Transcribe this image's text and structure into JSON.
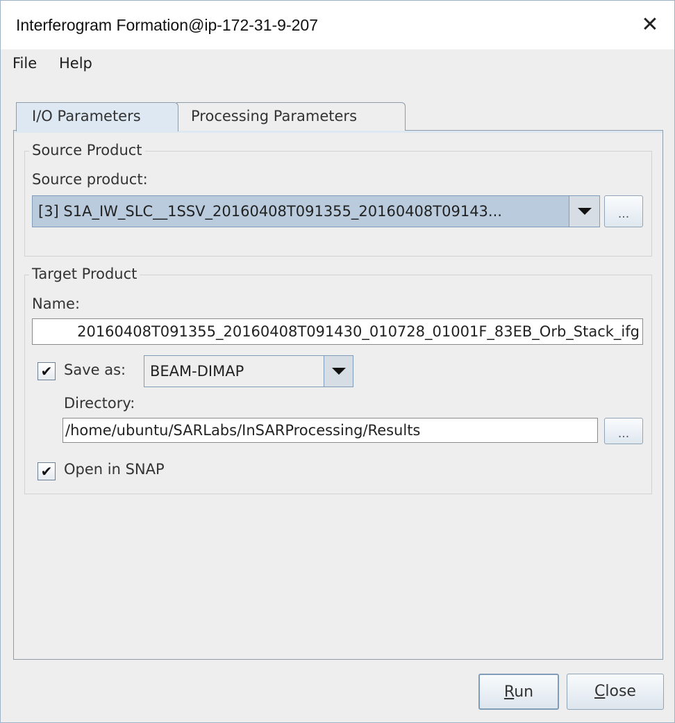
{
  "window": {
    "title": "Interferogram Formation@ip-172-31-9-207",
    "close_glyph": "✕"
  },
  "menu": {
    "items": [
      "File",
      "Help"
    ]
  },
  "tabs": [
    {
      "label": "I/O Parameters",
      "active": true
    },
    {
      "label": "Processing Parameters",
      "active": false
    }
  ],
  "source": {
    "group_title": "Source Product",
    "field_label": "Source product:",
    "selected_value": "[3] S1A_IW_SLC__1SSV_20160408T091355_20160408T09143...",
    "browse_label": "..."
  },
  "target": {
    "group_title": "Target Product",
    "name_label": "Name:",
    "name_value": "20160408T091355_20160408T091430_010728_01001F_83EB_Orb_Stack_ifg",
    "save_as": {
      "checked": true,
      "check_glyph": "✔",
      "label": "Save as:",
      "format": "BEAM-DIMAP"
    },
    "directory_label": "Directory:",
    "directory_value": "/home/ubuntu/SARLabs/InSARProcessing/Results",
    "browse_label": "...",
    "open_in_snap": {
      "checked": true,
      "check_glyph": "✔",
      "label": "Open in SNAP"
    }
  },
  "buttons": {
    "run": {
      "first": "R",
      "rest": "un"
    },
    "close": {
      "first": "C",
      "rest": "lose"
    }
  },
  "colors": {
    "tab_active": "#dde8f3",
    "combo_selected": "#b9cbdd",
    "window_bg": "#eeeeee"
  }
}
